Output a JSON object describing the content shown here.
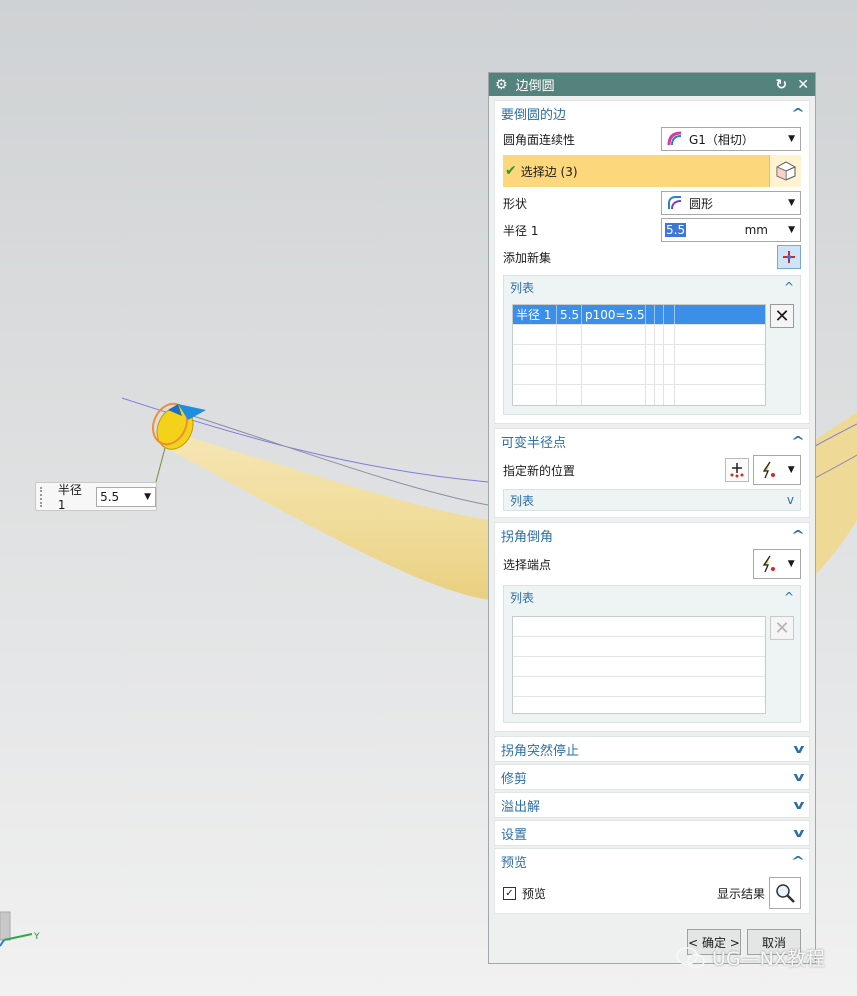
{
  "floating_input": {
    "label": "半径 1",
    "value": "5.5"
  },
  "dialog": {
    "title": "边倒圆",
    "sections": {
      "edges": {
        "header": "要倒圆的边",
        "continuity_label": "圆角面连续性",
        "continuity_value": "G1（相切）",
        "select_edge_label": "选择边 (3)",
        "shape_label": "形状",
        "shape_value": "圆形",
        "radius_label": "半径 1",
        "radius_value": "5.5",
        "radius_unit": "mm",
        "add_set_label": "添加新集",
        "list": {
          "header": "列表",
          "rows": [
            {
              "c1": "半径 1",
              "c2": "5.5",
              "c3": "p100=5.5"
            }
          ]
        }
      },
      "variable": {
        "header": "可变半径点",
        "new_location_label": "指定新的位置",
        "list_header": "列表"
      },
      "corner": {
        "header": "拐角倒角",
        "select_end_label": "选择端点",
        "list_header": "列表"
      },
      "corner_stop": {
        "header": "拐角突然停止"
      },
      "trim": {
        "header": "修剪"
      },
      "overflow": {
        "header": "溢出解"
      },
      "settings": {
        "header": "设置"
      },
      "preview": {
        "header": "预览",
        "preview_label": "预览",
        "show_result_label": "显示结果"
      }
    },
    "footer": {
      "ok_label": "< 确定 >",
      "cancel_label": "取消"
    }
  },
  "axis_label": "Y",
  "watermark": "UG—NX教程",
  "colors": {
    "title_bar": "#54837d",
    "section_header": "#2b6fa7",
    "selection_highlight": "#fcd77b",
    "list_selected": "#3b8fe8",
    "part": "#f2dfa0"
  }
}
